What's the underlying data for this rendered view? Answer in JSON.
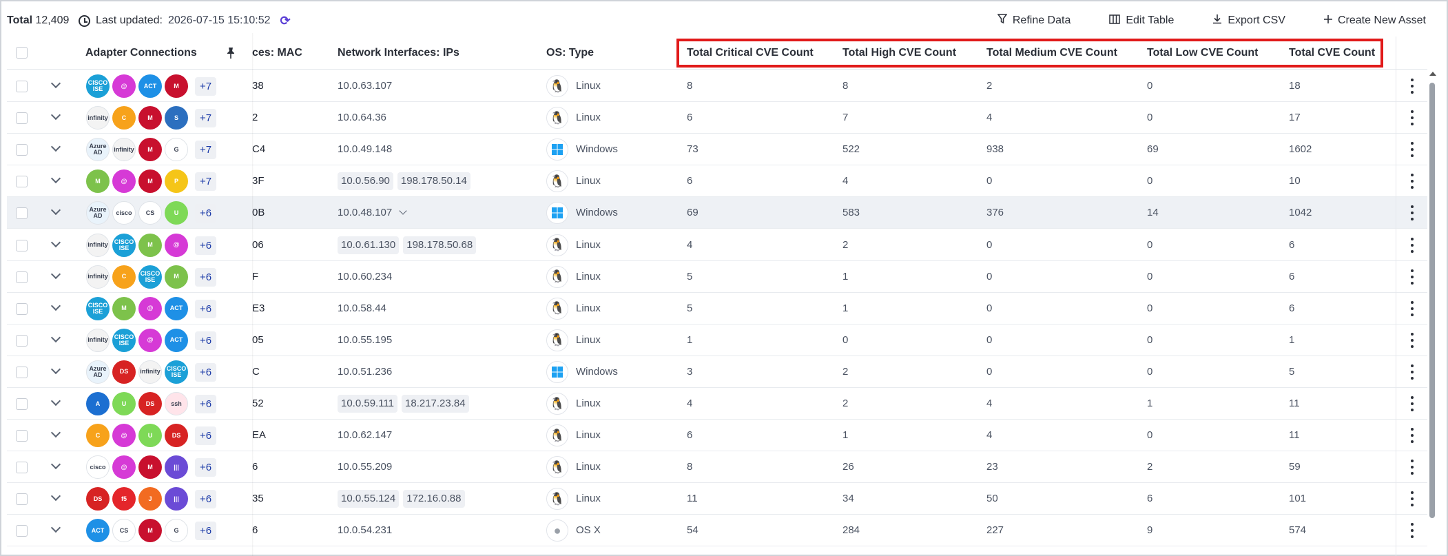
{
  "toolbar": {
    "total_label": "Total",
    "total_value": "12,409",
    "last_updated_label": "Last updated:",
    "last_updated_value": "2026-07-15 15:10:52",
    "refine_label": "Refine Data",
    "edit_table_label": "Edit Table",
    "export_label": "Export CSV",
    "create_label": "Create New Asset"
  },
  "columns": {
    "adapters": "Adapter Connections",
    "mac": "ces: MAC",
    "ips": "Network Interfaces: IPs",
    "os": "OS: Type",
    "critical": "Total Critical CVE Count",
    "high": "Total High CVE Count",
    "medium": "Total Medium CVE Count",
    "low": "Total Low CVE Count",
    "total": "Total CVE Count"
  },
  "adapter_icons": {
    "cisco": {
      "label": "CISCO ISE",
      "color": "#1ba0d7"
    },
    "infinity": {
      "label": "infinity",
      "color": "#f3f3f3"
    },
    "act": {
      "label": "ACT",
      "color": "#1e90e6"
    },
    "mcafee": {
      "label": "M",
      "color": "#c8102e"
    },
    "stc": {
      "label": "S",
      "color": "#2c6fbf"
    },
    "chef": {
      "label": "C",
      "color": "#f7a21b"
    },
    "azuread": {
      "label": "Azure AD",
      "color": "#e9f3fb"
    },
    "google": {
      "label": "G",
      "color": "#ffffff"
    },
    "mdm": {
      "label": "M",
      "color": "#7dc24b"
    },
    "puppet": {
      "label": "P",
      "color": "#f5c518"
    },
    "wintel": {
      "label": "win",
      "color": "#ffffff"
    },
    "crowdstrike": {
      "label": "CS",
      "color": "#ffffff"
    },
    "greenshield": {
      "label": "U",
      "color": "#7ed957"
    },
    "azure": {
      "label": "A",
      "color": "#1c6fd1"
    },
    "ds": {
      "label": "DS",
      "color": "#d72323"
    },
    "swan": {
      "label": "ssh",
      "color": "#ffe4ea"
    },
    "vuln": {
      "label": "|||",
      "color": "#6b4bd6"
    },
    "f5": {
      "label": "f5",
      "color": "#e4262b"
    },
    "orange": {
      "label": "J",
      "color": "#f26b21"
    },
    "purple": {
      "label": "@",
      "color": "#d63ad6"
    },
    "ciscoadp": {
      "label": "cisco",
      "color": "#ffffff"
    }
  },
  "rows": [
    {
      "adapters": [
        "cisco",
        "purple",
        "act",
        "mcafee"
      ],
      "more": "+7",
      "mac": "38",
      "ips": [
        "10.0.63.107"
      ],
      "ip_chips": false,
      "os_type": "Linux",
      "critical": "8",
      "high": "8",
      "medium": "2",
      "low": "0",
      "total": "18"
    },
    {
      "adapters": [
        "infinity",
        "chef",
        "mcafee",
        "stc"
      ],
      "more": "+7",
      "mac": "2",
      "ips": [
        "10.0.64.36"
      ],
      "ip_chips": false,
      "os_type": "Linux",
      "critical": "6",
      "high": "7",
      "medium": "4",
      "low": "0",
      "total": "17"
    },
    {
      "adapters": [
        "azuread",
        "infinity",
        "mcafee",
        "google"
      ],
      "more": "+7",
      "mac": "C4",
      "ips": [
        "10.0.49.148"
      ],
      "ip_chips": false,
      "os_type": "Windows",
      "critical": "73",
      "high": "522",
      "medium": "938",
      "low": "69",
      "total": "1602"
    },
    {
      "adapters": [
        "mdm",
        "purple",
        "mcafee",
        "puppet"
      ],
      "more": "+7",
      "mac": "3F",
      "ips": [
        "10.0.56.90",
        "198.178.50.14"
      ],
      "ip_chips": true,
      "os_type": "Linux",
      "critical": "6",
      "high": "4",
      "medium": "0",
      "low": "0",
      "total": "10"
    },
    {
      "adapters": [
        "azuread",
        "ciscoadp",
        "crowdstrike",
        "greenshield"
      ],
      "more": "+6",
      "mac": "0B",
      "ips": [
        "10.0.48.107"
      ],
      "ip_chips": false,
      "os_type": "Windows",
      "critical": "69",
      "high": "583",
      "medium": "376",
      "low": "14",
      "total": "1042"
    },
    {
      "adapters": [
        "infinity",
        "cisco",
        "mdm",
        "purple"
      ],
      "more": "+6",
      "mac": "06",
      "ips": [
        "10.0.61.130",
        "198.178.50.68"
      ],
      "ip_chips": true,
      "os_type": "Linux",
      "critical": "4",
      "high": "2",
      "medium": "0",
      "low": "0",
      "total": "6"
    },
    {
      "adapters": [
        "infinity",
        "chef",
        "cisco",
        "mdm"
      ],
      "more": "+6",
      "mac": "F",
      "ips": [
        "10.0.60.234"
      ],
      "ip_chips": false,
      "os_type": "Linux",
      "critical": "5",
      "high": "1",
      "medium": "0",
      "low": "0",
      "total": "6"
    },
    {
      "adapters": [
        "cisco",
        "mdm",
        "purple",
        "act"
      ],
      "more": "+6",
      "mac": "E3",
      "ips": [
        "10.0.58.44"
      ],
      "ip_chips": false,
      "os_type": "Linux",
      "critical": "5",
      "high": "1",
      "medium": "0",
      "low": "0",
      "total": "6"
    },
    {
      "adapters": [
        "infinity",
        "cisco",
        "purple",
        "act"
      ],
      "more": "+6",
      "mac": "05",
      "ips": [
        "10.0.55.195"
      ],
      "ip_chips": false,
      "os_type": "Linux",
      "critical": "1",
      "high": "0",
      "medium": "0",
      "low": "0",
      "total": "1"
    },
    {
      "adapters": [
        "azuread",
        "ds",
        "infinity",
        "cisco"
      ],
      "more": "+6",
      "mac": "C",
      "ips": [
        "10.0.51.236"
      ],
      "ip_chips": false,
      "os_type": "Windows",
      "critical": "3",
      "high": "2",
      "medium": "0",
      "low": "0",
      "total": "5"
    },
    {
      "adapters": [
        "azure",
        "greenshield",
        "ds",
        "swan"
      ],
      "more": "+6",
      "mac": "52",
      "ips": [
        "10.0.59.111",
        "18.217.23.84"
      ],
      "ip_chips": true,
      "os_type": "Linux",
      "critical": "4",
      "high": "2",
      "medium": "4",
      "low": "1",
      "total": "11"
    },
    {
      "adapters": [
        "chef",
        "purple",
        "greenshield",
        "ds"
      ],
      "more": "+6",
      "mac": "EA",
      "ips": [
        "10.0.62.147"
      ],
      "ip_chips": false,
      "os_type": "Linux",
      "critical": "6",
      "high": "1",
      "medium": "4",
      "low": "0",
      "total": "11"
    },
    {
      "adapters": [
        "ciscoadp",
        "purple",
        "mcafee",
        "vuln"
      ],
      "more": "+6",
      "mac": "6",
      "ips": [
        "10.0.55.209"
      ],
      "ip_chips": false,
      "os_type": "Linux",
      "critical": "8",
      "high": "26",
      "medium": "23",
      "low": "2",
      "total": "59"
    },
    {
      "adapters": [
        "ds",
        "f5",
        "orange",
        "vuln"
      ],
      "more": "+6",
      "mac": "35",
      "ips": [
        "10.0.55.124",
        "172.16.0.88"
      ],
      "ip_chips": true,
      "os_type": "Linux",
      "critical": "11",
      "high": "34",
      "medium": "50",
      "low": "6",
      "total": "101"
    },
    {
      "adapters": [
        "act",
        "crowdstrike",
        "mcafee",
        "google"
      ],
      "more": "+6",
      "mac": "6",
      "ips": [
        "10.0.54.231"
      ],
      "ip_chips": false,
      "os_type": "OS X",
      "critical": "54",
      "high": "284",
      "medium": "227",
      "low": "9",
      "total": "574"
    }
  ]
}
